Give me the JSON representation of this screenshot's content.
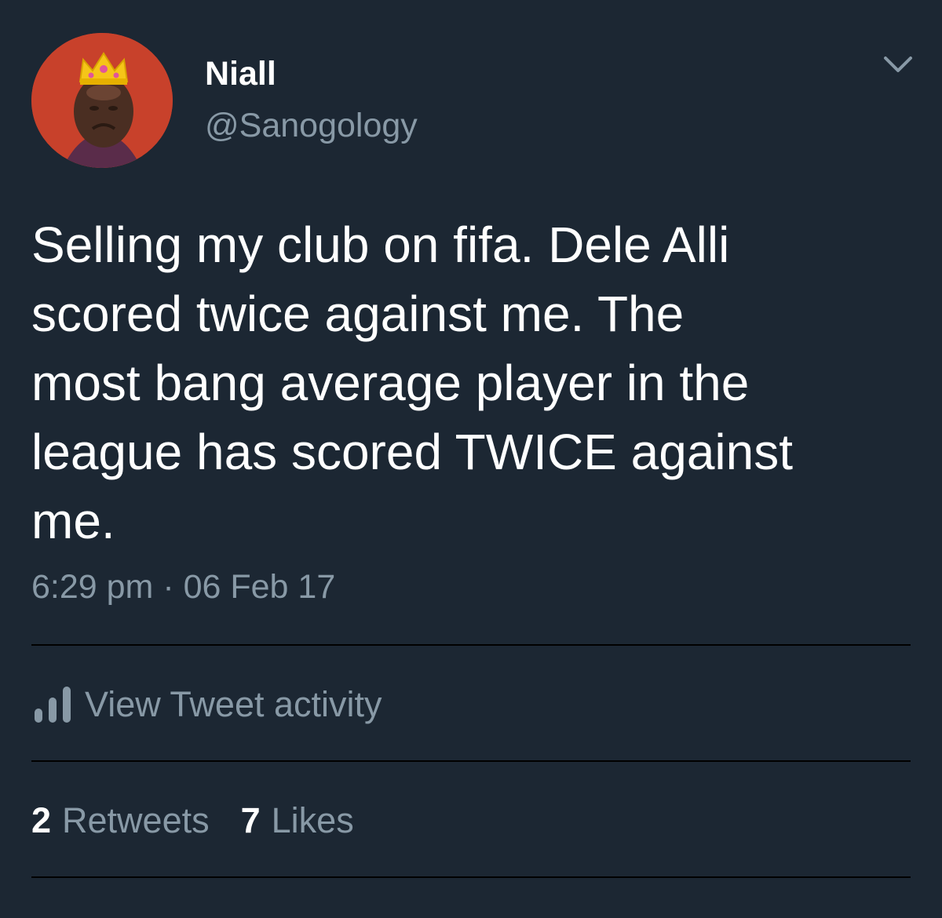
{
  "tweet": {
    "author_name": "Niall",
    "author_handle": "@Sanogology",
    "text": "Selling my club on fifa. Dele Alli\nscored twice against me. The\nmost bang average player in the\nleague has scored TWICE against\nme.",
    "timestamp": "6:29 pm · 06 Feb 17",
    "activity_label": "View Tweet activity",
    "retweets_count": "2",
    "retweets_label": "Retweets",
    "likes_count": "7",
    "likes_label": "Likes"
  },
  "icons": {
    "avatar": "crying-face-with-crown-avatar",
    "menu": "chevron-down-icon",
    "activity": "bar-chart-icon"
  },
  "colors": {
    "background": "#1c2733",
    "primary_text": "#ffffff",
    "secondary_text": "#8899a6",
    "divider": "#000000",
    "avatar_bg": "#c8412b"
  }
}
